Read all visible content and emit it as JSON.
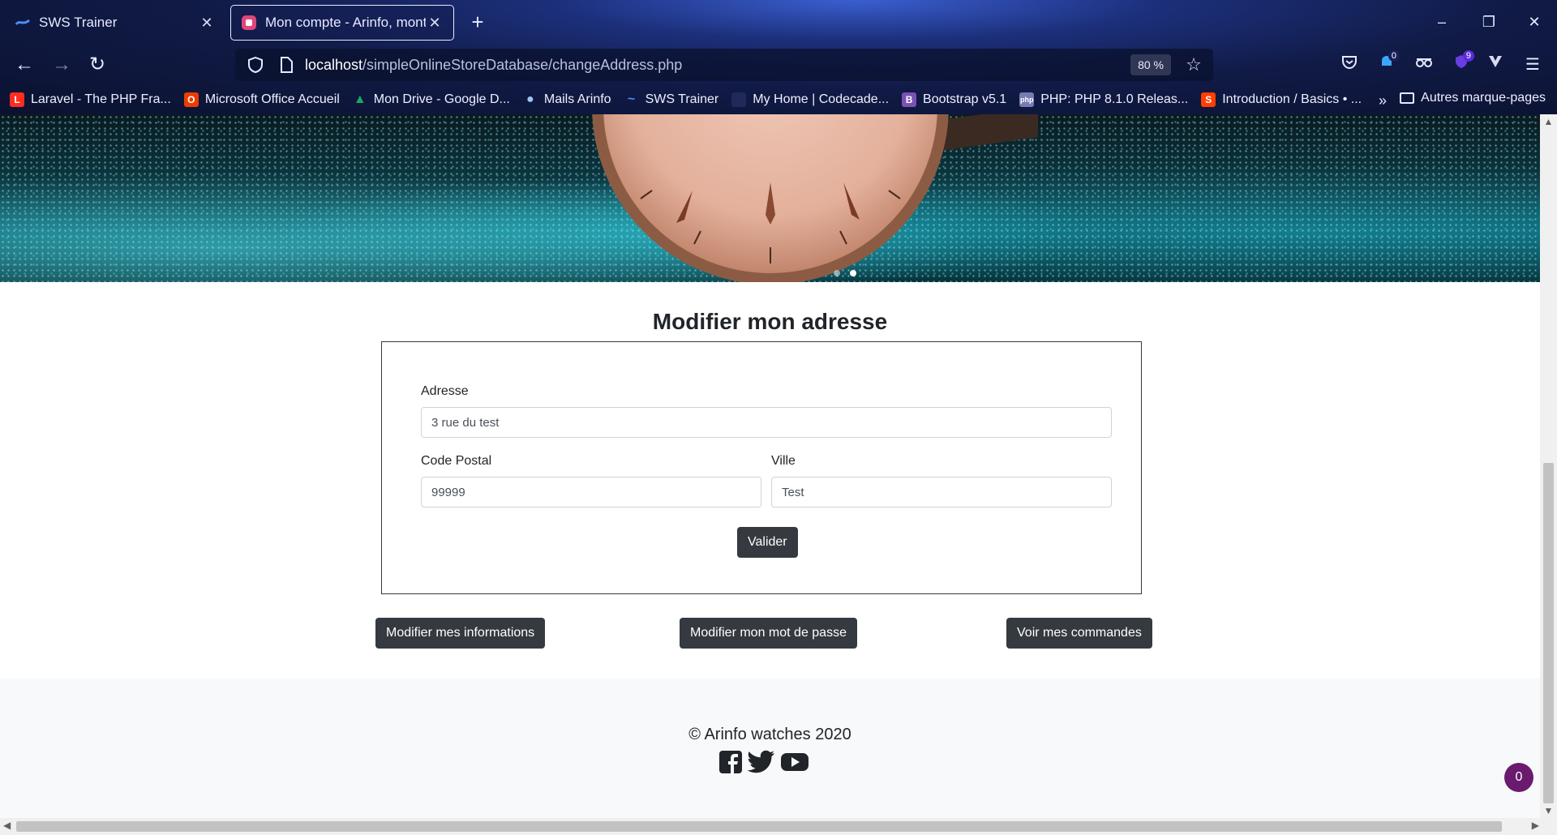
{
  "browser": {
    "tabs": [
      {
        "title": "SWS Trainer",
        "favicon": "sws-icon",
        "active": false
      },
      {
        "title": "Mon compte - Arinfo, montres à",
        "favicon": "arinfo-icon",
        "active": true
      }
    ],
    "new_tab": "+",
    "window_controls": {
      "minimize": "–",
      "restore": "❐",
      "close": "✕"
    },
    "url_host": "localhost",
    "url_path": "/simpleOnlineStoreDatabase/changeAddress.php",
    "zoom": "80 %",
    "extensions": [
      {
        "name": "pocket-icon",
        "badge": ""
      },
      {
        "name": "notification-icon",
        "badge": "0"
      },
      {
        "name": "spy-glasses-icon",
        "badge": ""
      },
      {
        "name": "extension-shield-icon",
        "badge": "9"
      },
      {
        "name": "vivaldi-v-icon",
        "badge": ""
      },
      {
        "name": "menu-icon",
        "badge": ""
      }
    ],
    "bookmarks": [
      {
        "label": "Laravel - The PHP Fra...",
        "color": "#ff2d20",
        "glyph": "L"
      },
      {
        "label": "Microsoft Office Accueil",
        "color": "#eb3c00",
        "glyph": "O"
      },
      {
        "label": "Mon Drive - Google D...",
        "color": "#1fa463",
        "glyph": "▲"
      },
      {
        "label": "Mails Arinfo",
        "color": "#6fa8dc",
        "glyph": "●"
      },
      {
        "label": "SWS Trainer",
        "color": "#3a6ee8",
        "glyph": "~"
      },
      {
        "label": "My Home | Codecade...",
        "color": "#1f2a5a",
        "glyph": ""
      },
      {
        "label": "Bootstrap v5.1",
        "color": "#7952b3",
        "glyph": "B"
      },
      {
        "label": "PHP: PHP 8.1.0 Releas...",
        "color": "#777bb3",
        "glyph": "php"
      },
      {
        "label": "Introduction / Basics • ...",
        "color": "#ff3e00",
        "glyph": "S"
      }
    ],
    "bookmarks_more": "»",
    "other_bookmarks": "Autres marque-pages"
  },
  "page": {
    "section_title": "Modifier mon adresse",
    "form": {
      "address_label": "Adresse",
      "address_value": "3 rue du test",
      "postal_label": "Code Postal",
      "postal_value": "99999",
      "city_label": "Ville",
      "city_value": "Test",
      "submit_label": "Valider"
    },
    "actions": {
      "edit_info": "Modifier mes informations",
      "edit_password": "Modifier mon mot de passe",
      "view_orders": "Voir mes commandes"
    },
    "footer": {
      "copyright": "© Arinfo watches 2020",
      "socials": [
        "facebook-icon",
        "twitter-icon",
        "youtube-icon"
      ]
    },
    "floating_badge": "0"
  },
  "colors": {
    "button_dark": "#343a40",
    "footer_bg": "#f8f9fa",
    "badge_purple": "#6a1b6e"
  }
}
